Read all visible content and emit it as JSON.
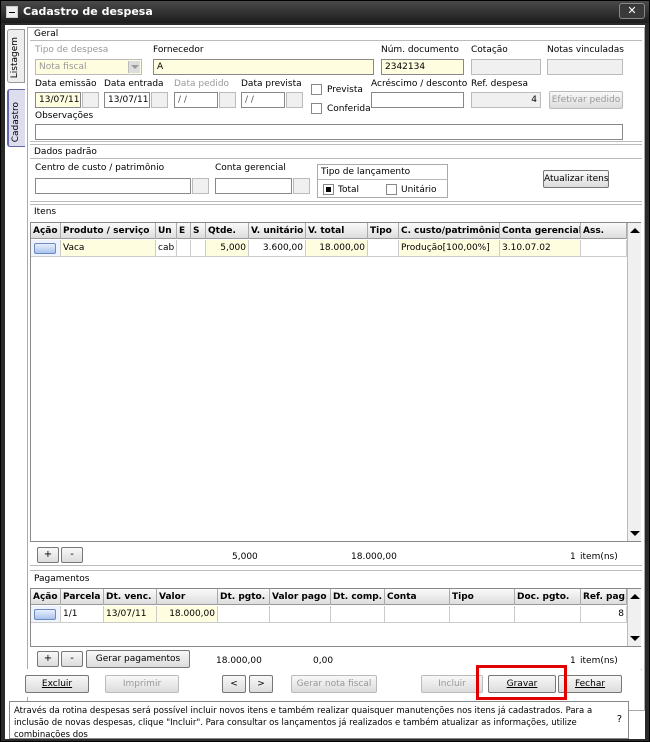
{
  "window": {
    "title": "Cadastro de despesa",
    "close_glyph": "✕"
  },
  "side_tabs": [
    {
      "label": "Listagem"
    },
    {
      "label": "Cadastro"
    }
  ],
  "geral": {
    "section_label": "Geral",
    "tipo_despesa": {
      "label": "Tipo de despesa",
      "value": "Nota fiscal"
    },
    "fornecedor": {
      "label": "Fornecedor",
      "value": "A"
    },
    "num_documento": {
      "label": "Núm. documento",
      "value": "2342134"
    },
    "cotacao": {
      "label": "Cotação",
      "value": ""
    },
    "notas_vinculadas": {
      "label": "Notas vinculadas",
      "value": ""
    },
    "data_emissao": {
      "label": "Data emissão",
      "value": "13/07/11"
    },
    "data_entrada": {
      "label": "Data entrada",
      "value": "13/07/11"
    },
    "data_pedido": {
      "label": "Data pedido",
      "value": "/ /"
    },
    "data_prevista": {
      "label": "Data prevista",
      "value": "/ /"
    },
    "prevista": {
      "label": "Prevista",
      "checked": false
    },
    "conferida": {
      "label": "Conferida",
      "checked": false
    },
    "acrescimo": {
      "label": "Acréscimo / desconto",
      "value": ""
    },
    "ref_despesa": {
      "label": "Ref. despesa",
      "value": "4"
    },
    "efetivar_label": "Efetivar pedido",
    "observacoes": {
      "label": "Observações",
      "value": ""
    }
  },
  "dados_padrao": {
    "section_label": "Dados padrão",
    "centro_custo": {
      "label": "Centro de custo / patrimônio",
      "value": ""
    },
    "conta_gerencial": {
      "label": "Conta gerencial",
      "value": ""
    },
    "tipo_lancamento": {
      "label": "Tipo de lançamento",
      "options": [
        {
          "label": "Total",
          "checked": true
        },
        {
          "label": "Unitário",
          "checked": false
        }
      ]
    },
    "atualizar_label": "Atualizar itens"
  },
  "itens": {
    "section_label": "Itens",
    "columns": [
      "Ação",
      "Produto / serviço",
      "Un",
      "E",
      "S",
      "Qtde.",
      "V. unitário",
      "V. total",
      "Tipo",
      "C. custo/patrimônio",
      "Conta gerencial",
      "Ass."
    ],
    "rows": [
      {
        "produto": "Vaca",
        "un": "cab",
        "e": "",
        "s": "",
        "qtde": "5,000",
        "v_unitario": "3.600,00",
        "v_total": "18.000,00",
        "tipo": "",
        "ccusto": "Produção[100,00%]",
        "conta": "3.10.07.02",
        "ass": ""
      }
    ],
    "add_label": "+",
    "remove_label": "-",
    "total_qtde": "5,000",
    "total_valor": "18.000,00",
    "count": "1",
    "count_unit": "item(ns)"
  },
  "pagamentos": {
    "section_label": "Pagamentos",
    "columns": [
      "Ação",
      "Parcela",
      "Dt. venc.",
      "Valor",
      "Dt. pgto.",
      "Valor pago",
      "Dt. comp.",
      "Conta",
      "Tipo",
      "Doc. pgto.",
      "Ref. pag."
    ],
    "rows": [
      {
        "parcela": "1/1",
        "dt_venc": "13/07/11",
        "valor": "18.000,00",
        "dt_pgto": "",
        "valor_pago": "",
        "dt_comp": "",
        "conta": "",
        "tipo": "",
        "doc": "",
        "ref": "8"
      }
    ],
    "add_label": "+",
    "remove_label": "-",
    "gerar_label": "Gerar pagamentos",
    "total_valor": "18.000,00",
    "total_pago": "0,00",
    "count": "1",
    "count_unit": "item(ns)"
  },
  "toolbar": {
    "excluir": "Excluir",
    "imprimir": "Imprimir",
    "prev": "<",
    "next": ">",
    "gerar_nota": "Gerar nota fiscal",
    "incluir": "Incluir",
    "gravar": "Gravar",
    "fechar": "Fechar"
  },
  "status_text": "Através da rotina despesas será possível incluir novos itens e também realizar quaisquer manutenções nos itens já cadastrados. Para a inclusão de novas despesas, clique \"Incluir\". Para consultar os lançamentos já realizados e também atualizar as informações, utilize combinações dos",
  "help_glyph": "?",
  "colors": {
    "highlight": "#e00000",
    "yellow_field": "#fffde0",
    "title_bar": "#1c1c1c"
  }
}
